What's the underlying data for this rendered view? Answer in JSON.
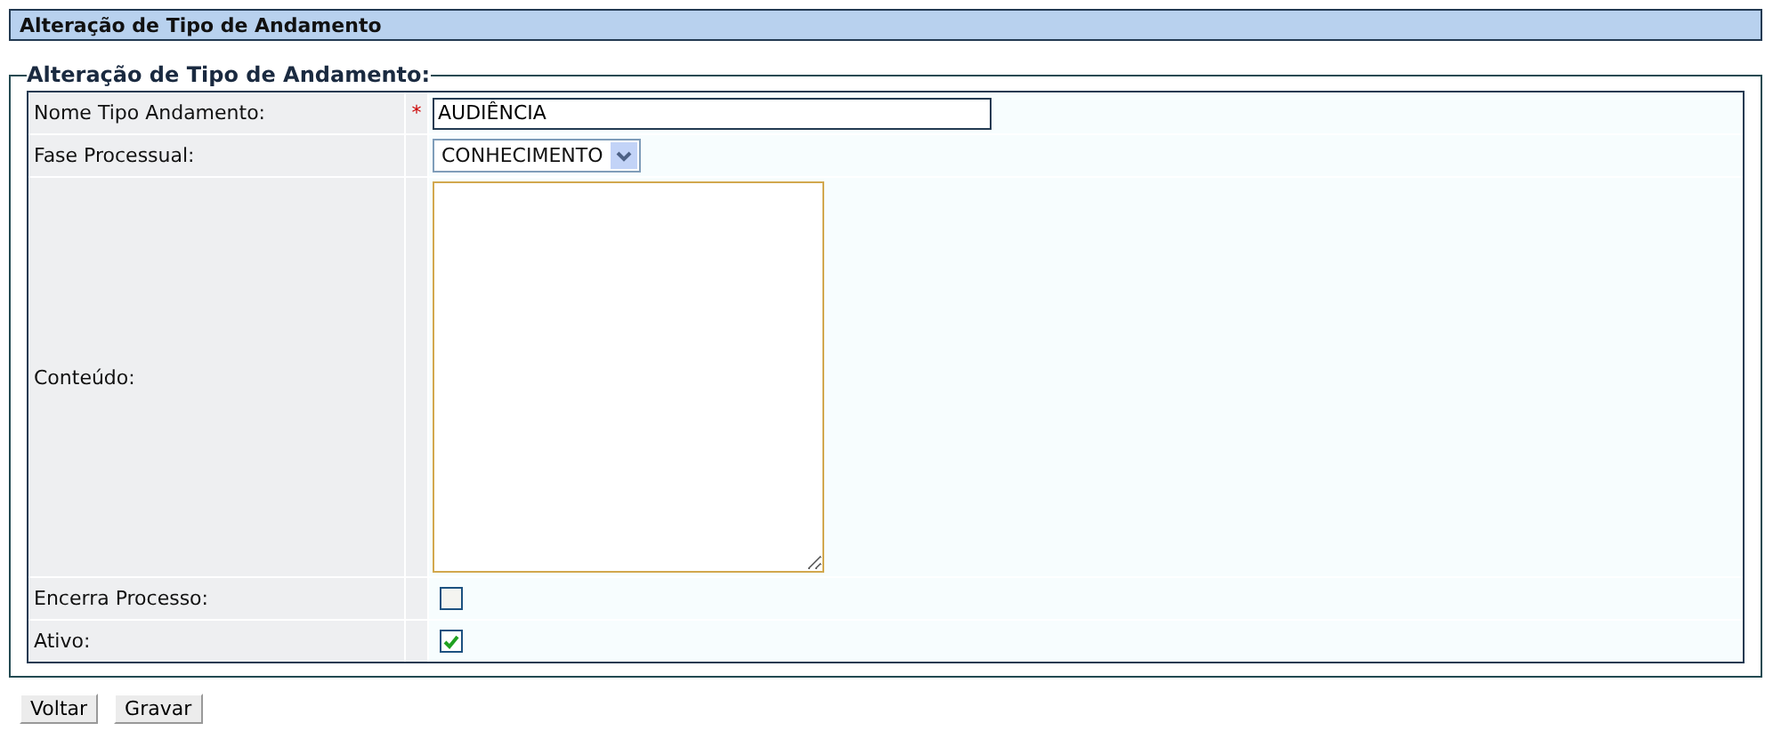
{
  "header": {
    "title": "Alteração de Tipo de Andamento"
  },
  "form": {
    "legend": "Alteração de Tipo de Andamento:",
    "rows": [
      {
        "kind": "text",
        "label": "Nome Tipo Andamento:",
        "marker": "*",
        "value": "AUDIÊNCIA"
      },
      {
        "kind": "select",
        "label": "Fase Processual:",
        "value": "CONHECIMENTO"
      },
      {
        "kind": "textarea",
        "label": "Conteúdo:"
      },
      {
        "kind": "checkbox",
        "label": "Encerra Processo:",
        "checked": false
      },
      {
        "kind": "checkbox",
        "label": "Ativo:",
        "checked": true
      }
    ]
  },
  "buttons": [
    "Voltar",
    "Gravar"
  ]
}
